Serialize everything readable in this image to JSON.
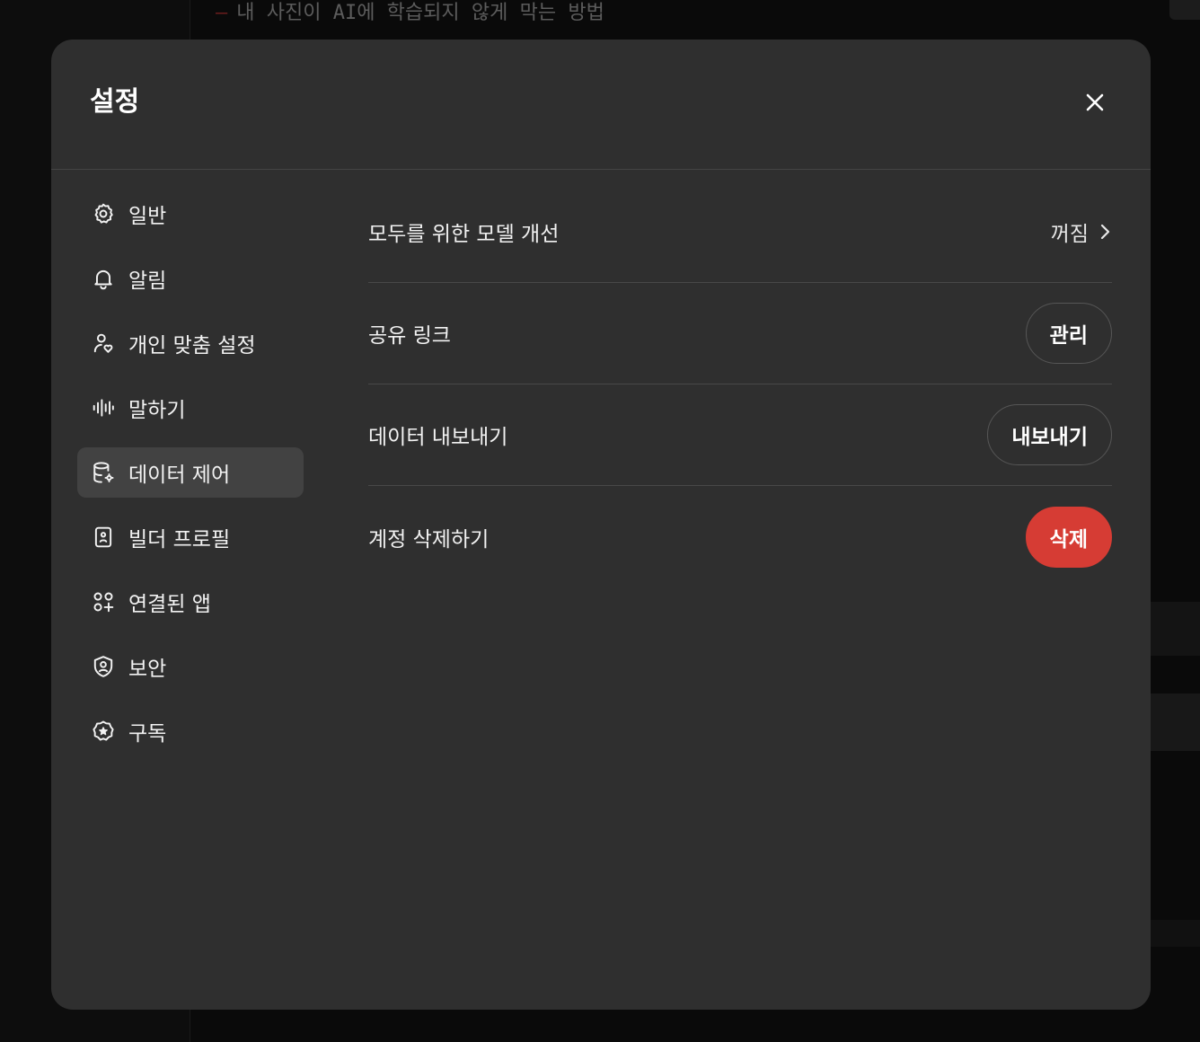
{
  "background": {
    "heading": "내 사진이 AI에 학습되지 않게 막는 방법",
    "heading_marker": "—"
  },
  "modal": {
    "title": "설정",
    "close_icon": "close-icon"
  },
  "nav": {
    "items": [
      {
        "label": "일반",
        "icon": "gear-icon"
      },
      {
        "label": "알림",
        "icon": "bell-icon"
      },
      {
        "label": "개인 맞춤 설정",
        "icon": "person-heart-icon"
      },
      {
        "label": "말하기",
        "icon": "waveform-icon"
      },
      {
        "label": "데이터 제어",
        "icon": "database-gear-icon",
        "active": true
      },
      {
        "label": "빌더 프로필",
        "icon": "id-card-icon"
      },
      {
        "label": "연결된 앱",
        "icon": "apps-grid-plus-icon"
      },
      {
        "label": "보안",
        "icon": "shield-user-icon"
      },
      {
        "label": "구독",
        "icon": "badge-star-icon"
      }
    ]
  },
  "content": {
    "rows": [
      {
        "label": "모두를 위한 모델 개선",
        "value": "꺼짐",
        "icon": "chevron-right-icon"
      },
      {
        "label": "공유 링크",
        "button": "관리"
      },
      {
        "label": "데이터 내보내기",
        "button": "내보내기"
      },
      {
        "label": "계정 삭제하기",
        "button": "삭제"
      }
    ]
  },
  "colors": {
    "modal_bg": "#2f2f2f",
    "active_nav_bg": "#424242",
    "danger": "#d63c34"
  }
}
